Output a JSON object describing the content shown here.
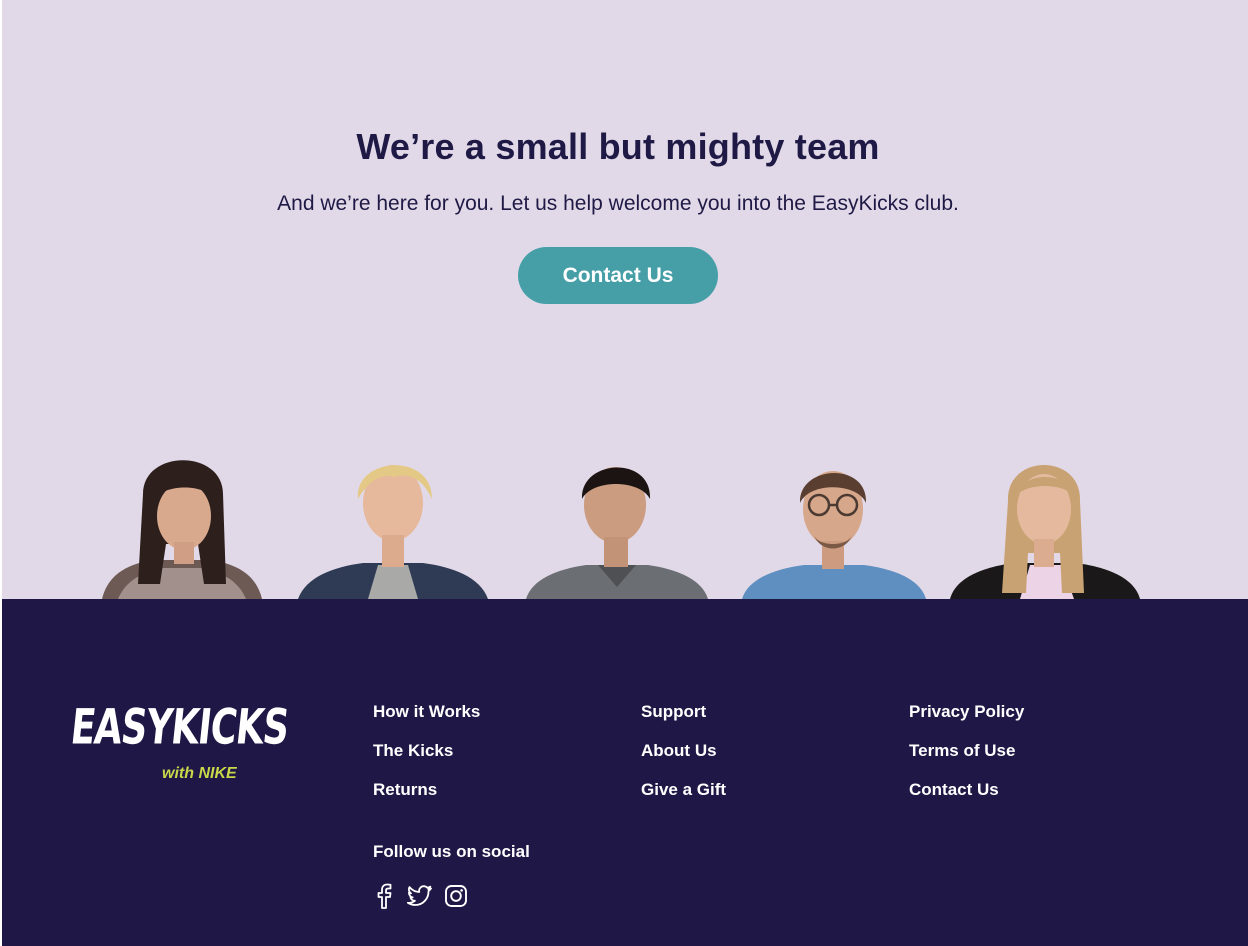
{
  "hero": {
    "title": "We’re a small but mighty team",
    "subtitle": "And we’re here for you. Let us help welcome you into the EasyKicks club.",
    "cta_label": "Contact Us",
    "background": "#e2d9e8",
    "accent": "#469fa7"
  },
  "team": {
    "members": [
      {
        "icon": "team-member-photo-1"
      },
      {
        "icon": "team-member-photo-2"
      },
      {
        "icon": "team-member-photo-3"
      },
      {
        "icon": "team-member-photo-4"
      },
      {
        "icon": "team-member-photo-5"
      }
    ]
  },
  "footer": {
    "background": "#1f1745",
    "logo": {
      "brand": "EASYKICKS",
      "tagline": "with NIKE"
    },
    "columns": [
      {
        "links": [
          "How it Works",
          "The Kicks",
          "Returns"
        ]
      },
      {
        "links": [
          "Support",
          "About Us",
          "Give a Gift"
        ]
      },
      {
        "links": [
          "Privacy Policy",
          "Terms of Use",
          "Contact Us"
        ]
      }
    ],
    "social": {
      "heading": "Follow us on social",
      "icons": [
        "facebook-icon",
        "twitter-icon",
        "instagram-icon"
      ]
    }
  }
}
